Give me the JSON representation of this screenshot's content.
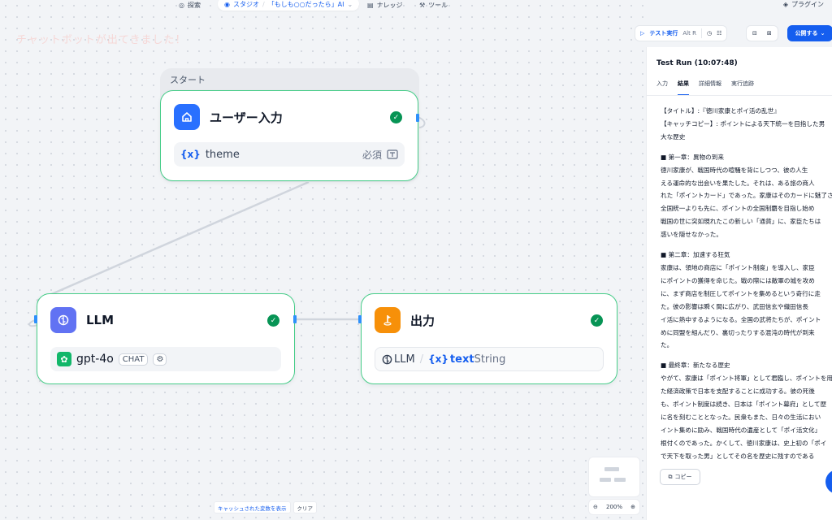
{
  "topnav": {
    "search": "探索",
    "studio": "スタジオ",
    "app_name": "「もしも○○だったら」AI",
    "knowledge": "ナレッジ",
    "tools": "ツール",
    "plugins": "プラグイン"
  },
  "notice": "チャットボットが出てきました！",
  "toolbar": {
    "test_run": "テスト実行",
    "shortcut": "Alt R",
    "publish": "公開する"
  },
  "start_group": {
    "label": "スタート"
  },
  "nodes": {
    "user_input": {
      "title": "ユーザー入力",
      "var_symbol": "{x}",
      "var_name": "theme",
      "required": "必須"
    },
    "llm": {
      "title": "LLM",
      "model": "gpt-4o",
      "mode": "CHAT"
    },
    "output": {
      "title": "出力",
      "ref_node": "LLM",
      "ref_var_symbol": "{x}",
      "ref_var": "text",
      "ref_type": "String"
    }
  },
  "canvas_footer": {
    "show_cached": "キャッシュされた変数を表示",
    "clear": "クリア",
    "zoom": "200%"
  },
  "panel": {
    "title": "Test Run (10:07:48)",
    "tabs": [
      "入力",
      "結果",
      "詳細情報",
      "実行追跡"
    ],
    "active_tab": "結果",
    "lines": [
      "【タイトル】:『徳川家康とポイ活の乱世』",
      "【キャッチコピー】: ポイントによる天下統一を目指した男",
      "大な歴史",
      "",
      "■ 第一章：異物の到来",
      "徳川家康が、戦国時代の喧騒を背にしつつ、彼の人生",
      "える運命的な出会いを果たした。それは、ある旅の商人",
      "れた「ポイントカード」であった。家康はそのカードに魅了さ",
      "全国統一よりも先に、ポイントの全国制覇を目指し始め",
      "戦国の世に突如現れたこの新しい「通貨」に、家臣たちは",
      "惑いを隠せなかった。",
      "",
      "■ 第二章：加速する狂気",
      "家康は、領地の商店に「ポイント制度」を導入し、家臣",
      "にポイントの獲得を命じた。戦の際には敵軍の城を攻め",
      "に、まず商店を制圧してポイントを集めるという奇行に走",
      "た。彼の影響は瞬く間に広がり、武田信玄や織田信長",
      "イ活に熱中するようになる。全国の武将たちが、ポイント",
      "めに同盟を組んだり、裏切ったりする混沌の時代が到来",
      "た。",
      "",
      "■ 最終章：新たなる歴史",
      "やがて、家康は「ポイント将軍」として君臨し、ポイントを用",
      "た経済政策で日本を支配することに成功する。彼の死後",
      "も、ポイント制度は続き、日本は「ポイント幕府」として歴",
      "に名を刻むこととなった。民衆もまた、日々の生活におい",
      "イント集めに励み、戦国時代の遺産として「ポイ活文化」",
      "根付くのであった。かくして、徳川家康は、史上初の「ポイ",
      "で天下を取った男」としてその名を歴史に残すのである"
    ],
    "copy": "コピー"
  },
  "colors": {
    "accent": "#155eef",
    "node_border": "#47cd89",
    "success": "#079455",
    "start_icon": "#2970ff",
    "llm_icon": "#6172f3",
    "output_icon": "#f79009"
  }
}
